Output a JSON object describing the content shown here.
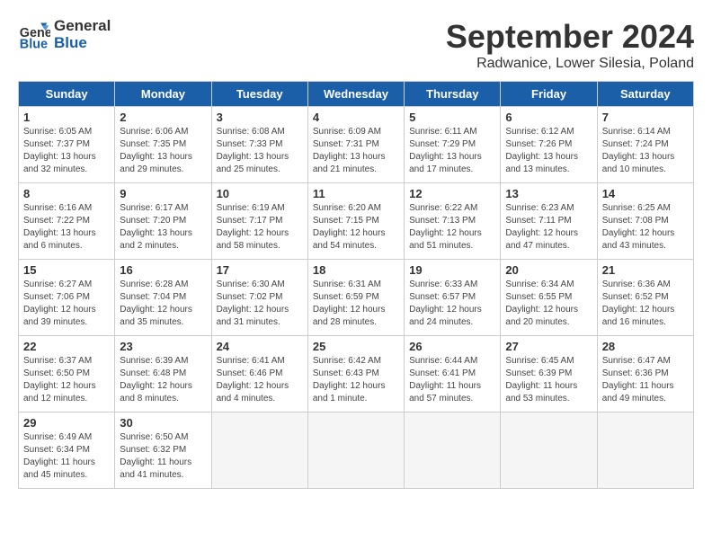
{
  "logo": {
    "line1": "General",
    "line2": "Blue"
  },
  "title": "September 2024",
  "location": "Radwanice, Lower Silesia, Poland",
  "days_of_week": [
    "Sunday",
    "Monday",
    "Tuesday",
    "Wednesday",
    "Thursday",
    "Friday",
    "Saturday"
  ],
  "weeks": [
    [
      {
        "num": "1",
        "info": "Sunrise: 6:05 AM\nSunset: 7:37 PM\nDaylight: 13 hours\nand 32 minutes."
      },
      {
        "num": "2",
        "info": "Sunrise: 6:06 AM\nSunset: 7:35 PM\nDaylight: 13 hours\nand 29 minutes."
      },
      {
        "num": "3",
        "info": "Sunrise: 6:08 AM\nSunset: 7:33 PM\nDaylight: 13 hours\nand 25 minutes."
      },
      {
        "num": "4",
        "info": "Sunrise: 6:09 AM\nSunset: 7:31 PM\nDaylight: 13 hours\nand 21 minutes."
      },
      {
        "num": "5",
        "info": "Sunrise: 6:11 AM\nSunset: 7:29 PM\nDaylight: 13 hours\nand 17 minutes."
      },
      {
        "num": "6",
        "info": "Sunrise: 6:12 AM\nSunset: 7:26 PM\nDaylight: 13 hours\nand 13 minutes."
      },
      {
        "num": "7",
        "info": "Sunrise: 6:14 AM\nSunset: 7:24 PM\nDaylight: 13 hours\nand 10 minutes."
      }
    ],
    [
      {
        "num": "8",
        "info": "Sunrise: 6:16 AM\nSunset: 7:22 PM\nDaylight: 13 hours\nand 6 minutes."
      },
      {
        "num": "9",
        "info": "Sunrise: 6:17 AM\nSunset: 7:20 PM\nDaylight: 13 hours\nand 2 minutes."
      },
      {
        "num": "10",
        "info": "Sunrise: 6:19 AM\nSunset: 7:17 PM\nDaylight: 12 hours\nand 58 minutes."
      },
      {
        "num": "11",
        "info": "Sunrise: 6:20 AM\nSunset: 7:15 PM\nDaylight: 12 hours\nand 54 minutes."
      },
      {
        "num": "12",
        "info": "Sunrise: 6:22 AM\nSunset: 7:13 PM\nDaylight: 12 hours\nand 51 minutes."
      },
      {
        "num": "13",
        "info": "Sunrise: 6:23 AM\nSunset: 7:11 PM\nDaylight: 12 hours\nand 47 minutes."
      },
      {
        "num": "14",
        "info": "Sunrise: 6:25 AM\nSunset: 7:08 PM\nDaylight: 12 hours\nand 43 minutes."
      }
    ],
    [
      {
        "num": "15",
        "info": "Sunrise: 6:27 AM\nSunset: 7:06 PM\nDaylight: 12 hours\nand 39 minutes."
      },
      {
        "num": "16",
        "info": "Sunrise: 6:28 AM\nSunset: 7:04 PM\nDaylight: 12 hours\nand 35 minutes."
      },
      {
        "num": "17",
        "info": "Sunrise: 6:30 AM\nSunset: 7:02 PM\nDaylight: 12 hours\nand 31 minutes."
      },
      {
        "num": "18",
        "info": "Sunrise: 6:31 AM\nSunset: 6:59 PM\nDaylight: 12 hours\nand 28 minutes."
      },
      {
        "num": "19",
        "info": "Sunrise: 6:33 AM\nSunset: 6:57 PM\nDaylight: 12 hours\nand 24 minutes."
      },
      {
        "num": "20",
        "info": "Sunrise: 6:34 AM\nSunset: 6:55 PM\nDaylight: 12 hours\nand 20 minutes."
      },
      {
        "num": "21",
        "info": "Sunrise: 6:36 AM\nSunset: 6:52 PM\nDaylight: 12 hours\nand 16 minutes."
      }
    ],
    [
      {
        "num": "22",
        "info": "Sunrise: 6:37 AM\nSunset: 6:50 PM\nDaylight: 12 hours\nand 12 minutes."
      },
      {
        "num": "23",
        "info": "Sunrise: 6:39 AM\nSunset: 6:48 PM\nDaylight: 12 hours\nand 8 minutes."
      },
      {
        "num": "24",
        "info": "Sunrise: 6:41 AM\nSunset: 6:46 PM\nDaylight: 12 hours\nand 4 minutes."
      },
      {
        "num": "25",
        "info": "Sunrise: 6:42 AM\nSunset: 6:43 PM\nDaylight: 12 hours\nand 1 minute."
      },
      {
        "num": "26",
        "info": "Sunrise: 6:44 AM\nSunset: 6:41 PM\nDaylight: 11 hours\nand 57 minutes."
      },
      {
        "num": "27",
        "info": "Sunrise: 6:45 AM\nSunset: 6:39 PM\nDaylight: 11 hours\nand 53 minutes."
      },
      {
        "num": "28",
        "info": "Sunrise: 6:47 AM\nSunset: 6:36 PM\nDaylight: 11 hours\nand 49 minutes."
      }
    ],
    [
      {
        "num": "29",
        "info": "Sunrise: 6:49 AM\nSunset: 6:34 PM\nDaylight: 11 hours\nand 45 minutes."
      },
      {
        "num": "30",
        "info": "Sunrise: 6:50 AM\nSunset: 6:32 PM\nDaylight: 11 hours\nand 41 minutes."
      },
      {
        "num": "",
        "info": "",
        "empty": true
      },
      {
        "num": "",
        "info": "",
        "empty": true
      },
      {
        "num": "",
        "info": "",
        "empty": true
      },
      {
        "num": "",
        "info": "",
        "empty": true
      },
      {
        "num": "",
        "info": "",
        "empty": true
      }
    ]
  ]
}
